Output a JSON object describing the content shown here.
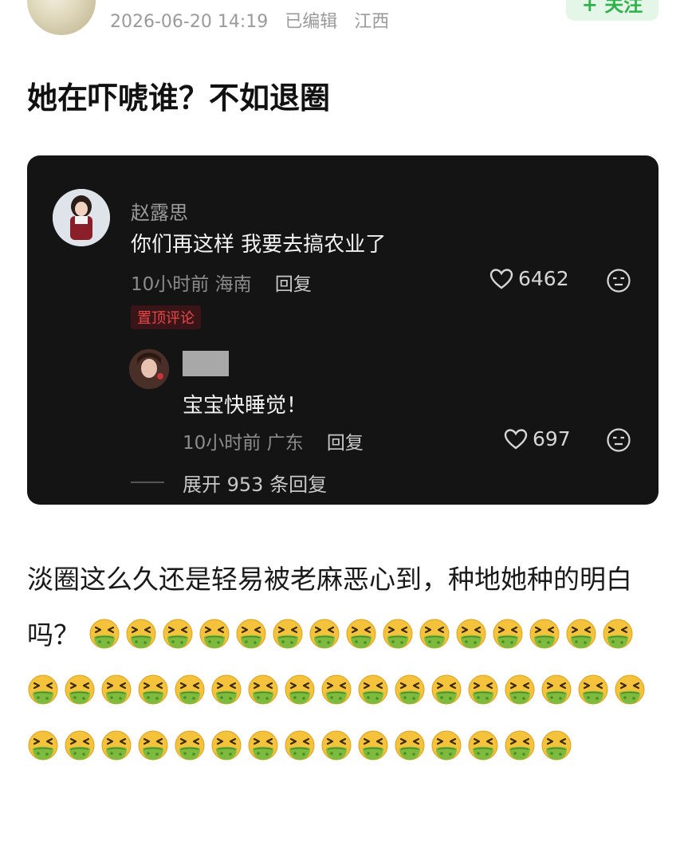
{
  "post": {
    "meta": {
      "date": "2026-06-20 14:19",
      "edited": "已编辑",
      "location": "江西"
    },
    "follow_label": "+ 关注",
    "title": "她在吓唬谁？不如退圈",
    "body_text": "淡圈这么久还是轻易被老麻恶心到，种地她种的明白吗？",
    "emoji_icon": "nauseated-face-icon",
    "emoji_count": 47
  },
  "embedded_comment": {
    "author": "赵露思",
    "text": "你们再这样 我要去搞农业了",
    "time": "10小时前",
    "location": "海南",
    "reply_label": "回复",
    "likes": "6462",
    "pinned_label": "置顶评论",
    "reply": {
      "text": "宝宝快睡觉！",
      "time": "10小时前",
      "location": "广东",
      "reply_label": "回复",
      "likes": "697"
    },
    "expand_label": "展开 953 条回复"
  },
  "colors": {
    "accent": "#2fb24b",
    "pin_red": "#e8474a",
    "card_bg": "#141414"
  }
}
